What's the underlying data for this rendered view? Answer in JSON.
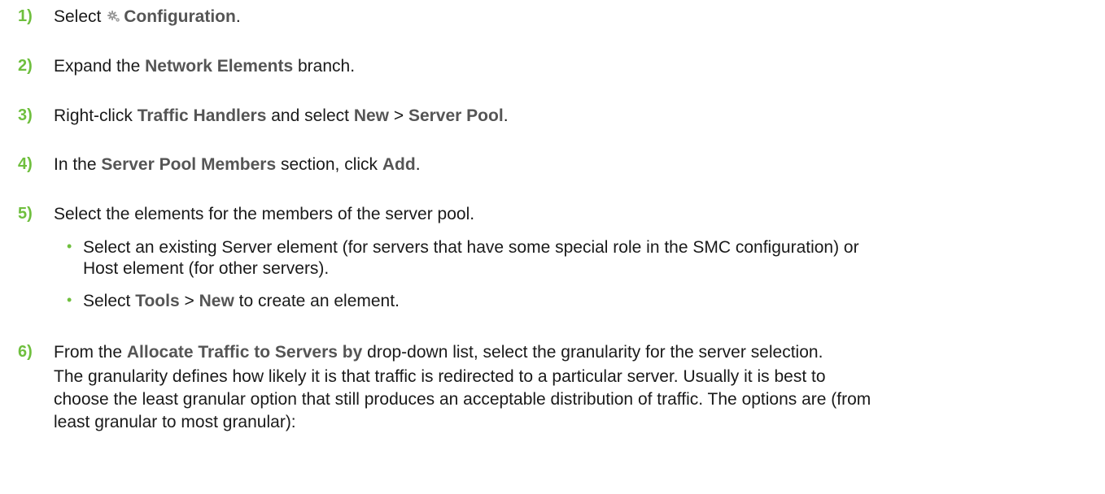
{
  "accent_color": "#6fbf3e",
  "steps": [
    {
      "num": "1)",
      "t1": "Select ",
      "b1": "Configuration",
      "t2": "."
    },
    {
      "num": "2)",
      "t1": "Expand the ",
      "b1": "Network Elements",
      "t2": " branch."
    },
    {
      "num": "3)",
      "t1": "Right-click ",
      "b1": "Traffic Handlers",
      "t2": " and select ",
      "b2": "New",
      "t3": " > ",
      "b3": "Server Pool",
      "t4": "."
    },
    {
      "num": "4)",
      "t1": "In the ",
      "b1": "Server Pool Members",
      "t2": " section, click ",
      "b2": "Add",
      "t3": "."
    },
    {
      "num": "5)",
      "t1": "Select the elements for the members of the server pool."
    },
    {
      "num": "6)",
      "t1": "From the ",
      "b1": "Allocate Traffic to Servers by",
      "t2": " drop-down list, select the granularity for the server selection."
    }
  ],
  "bullets": [
    {
      "l1": "Select an existing Server element (for servers that have some special role in the SMC configuration) or",
      "l2": "Host element (for other servers)."
    },
    {
      "t1": "Select ",
      "b1": "Tools",
      "t2": " > ",
      "b2": "New",
      "t3": " to create an element."
    }
  ],
  "step6_note": {
    "l1": "The granularity defines how likely it is that traffic is redirected to a particular server. Usually it is best to",
    "l2": "choose the least granular option that still produces an acceptable distribution of traffic. The options are (from",
    "l3": "least granular to most granular):"
  },
  "bullet_char": "•",
  "icons": {
    "configuration": "gear-icon"
  }
}
